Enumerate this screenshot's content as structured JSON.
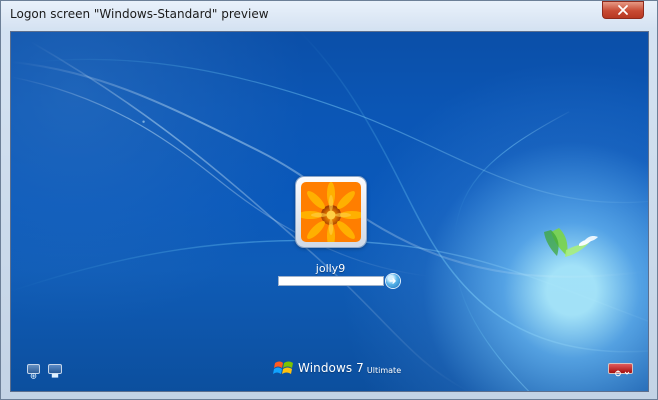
{
  "window": {
    "title": "Logon screen \"Windows-Standard\" preview"
  },
  "logon": {
    "username": "jolly9",
    "password_value": ""
  },
  "branding": {
    "product": "Windows 7",
    "edition": "Ultimate"
  },
  "icons": {
    "close": "close-icon",
    "submit": "arrow-right-icon",
    "ease_of_access": "ease-of-access-icon",
    "display": "display-icon",
    "power": "power-icon"
  },
  "colors": {
    "titlebar_top": "#e9f1fb",
    "titlebar_bottom": "#d6e3f2",
    "desktop_blue": "#0b56b5",
    "close_red": "#c84b34",
    "power_red": "#b41616"
  }
}
